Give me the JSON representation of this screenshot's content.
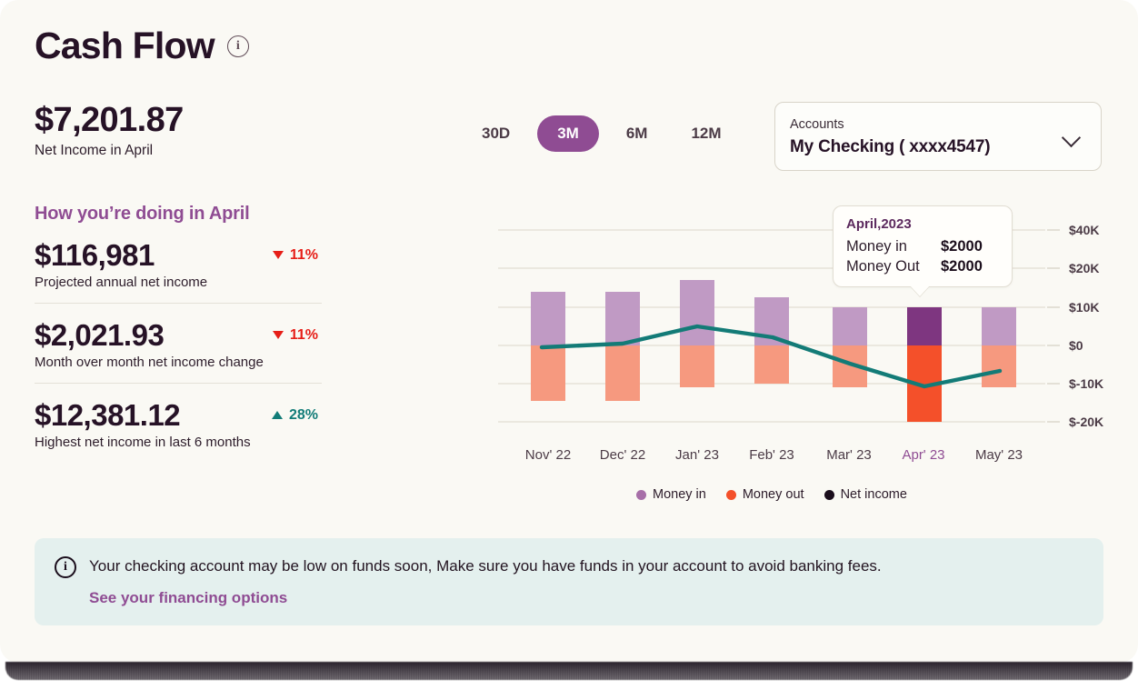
{
  "header": {
    "title": "Cash Flow",
    "info_icon": "info-icon"
  },
  "hero": {
    "value": "$7,201.87",
    "label": "Net Income in April"
  },
  "section": {
    "heading": "How you’re doing in April"
  },
  "stats": [
    {
      "value": "$116,981",
      "label": "Projected annual net income",
      "delta": "11%",
      "direction": "down"
    },
    {
      "value": "$2,021.93",
      "label": "Month over month net income change",
      "delta": "11%",
      "direction": "down"
    },
    {
      "value": "$12,381.12",
      "label": "Highest net income in last 6 months",
      "delta": "28%",
      "direction": "up"
    }
  ],
  "range_tabs": [
    {
      "label": "30D",
      "active": false
    },
    {
      "label": "3M",
      "active": true
    },
    {
      "label": "6M",
      "active": false
    },
    {
      "label": "12M",
      "active": false
    }
  ],
  "account_select": {
    "label": "Accounts",
    "value": "My Checking ( xxxx4547)",
    "chevron_icon": "chevron-down-icon"
  },
  "tooltip": {
    "title": "April,2023",
    "rows": [
      {
        "key": "Money in",
        "value": "$2000"
      },
      {
        "key": "Money Out",
        "value": "$2000"
      }
    ]
  },
  "legend": [
    {
      "label": "Money in",
      "color": "#A76FA8"
    },
    {
      "label": "Money out",
      "color": "#F4502A"
    },
    {
      "label": "Net income",
      "color": "#1B0E1C"
    }
  ],
  "alert": {
    "icon": "info-icon",
    "text": "Your checking account may be low on funds soon, Make sure you have funds in your account to avoid banking fees.",
    "link": "See your financing options"
  },
  "colors": {
    "card_bg": "#FAF9F4",
    "accent_purple": "#8F4C93",
    "money_in": "#C09AC4",
    "money_in_active": "#7E3680",
    "money_out": "#F6997F",
    "money_out_active": "#F4502A",
    "net_income_line": "#137B77",
    "down": "#E61E17",
    "up": "#127C78",
    "alert_bg": "#E4F0EE"
  },
  "chart_data": {
    "type": "bar",
    "title": "",
    "xlabel": "",
    "ylabel": "",
    "categories": [
      "Nov' 22",
      "Dec' 22",
      "Jan' 23",
      "Feb' 23",
      "Mar' 23",
      "Apr' 23",
      "May' 23"
    ],
    "highlight_category": "Apr' 23",
    "ytick_labels": [
      "$40K",
      "$20K",
      "$10K",
      "$0",
      "$-10K",
      "$-20K"
    ],
    "ytick_values": [
      40000,
      20000,
      10000,
      0,
      -10000,
      -20000
    ],
    "ylim": [
      -20000,
      40000
    ],
    "grid": true,
    "legend_position": "bottom",
    "series": [
      {
        "name": "Money in",
        "color": "#C09AC4",
        "values": [
          14000,
          14000,
          17000,
          12500,
          10000,
          10000,
          10000
        ]
      },
      {
        "name": "Money out",
        "color": "#F6997F",
        "values": [
          -14500,
          -14500,
          -11000,
          -10000,
          -11000,
          -20000,
          -10000
        ]
      },
      {
        "name": "Net income",
        "color": "#137B77",
        "type": "line",
        "values": [
          -500,
          0,
          5000,
          2500,
          -5000,
          -10500,
          -7000
        ]
      }
    ]
  }
}
